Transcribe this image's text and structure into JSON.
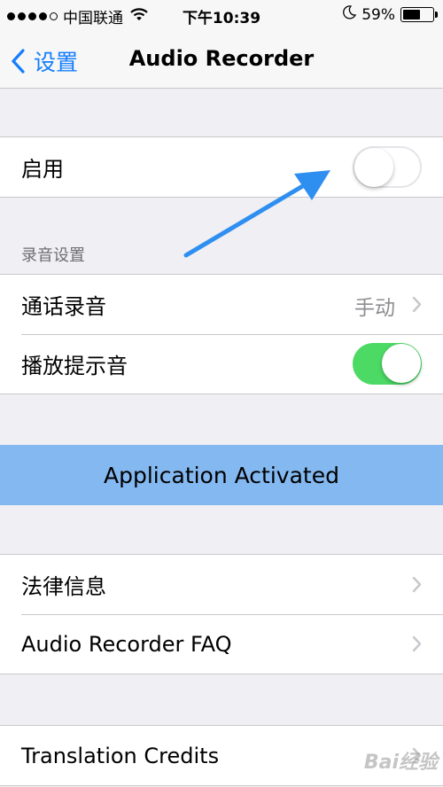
{
  "status_bar": {
    "carrier": "中国联通",
    "time": "下午10:39",
    "battery_percent": "59%",
    "battery_level": 0.59,
    "signal_dots_filled": 4,
    "signal_dots_total": 5
  },
  "nav": {
    "back_label": "设置",
    "title": "Audio Recorder"
  },
  "group1": {
    "enable_label": "启用",
    "enable_on": false
  },
  "recording_section": {
    "header": "录音设置",
    "call_recording_label": "通话录音",
    "call_recording_value": "手动",
    "prompt_tone_label": "播放提示音",
    "prompt_tone_on": true
  },
  "banner": {
    "text": "Application Activated"
  },
  "info_group": {
    "legal_label": "法律信息",
    "faq_label": "Audio Recorder FAQ"
  },
  "credits_group": {
    "credits_label": "Translation Credits"
  },
  "colors": {
    "accent": "#157efb",
    "toggle_on": "#4cd964",
    "banner_bg": "#84b8f0",
    "annotation_arrow": "#2f8ff0"
  },
  "watermark": "Bai经验"
}
